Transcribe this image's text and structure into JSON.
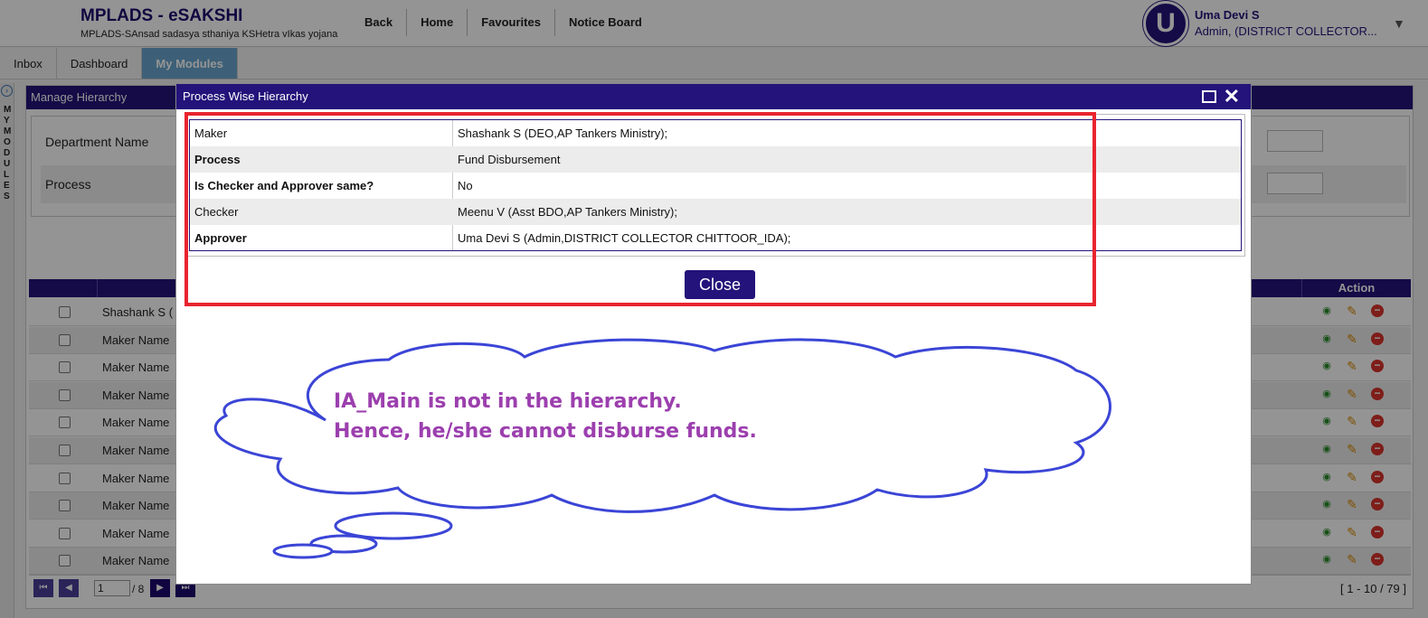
{
  "header": {
    "brand_title": "MPLADS - eSAKSHI",
    "brand_subtitle": "MPLADS-SAnsad sadasya sthaniya KSHetra vIkas yojana",
    "nav": [
      "Back",
      "Home",
      "Favourites",
      "Notice Board"
    ],
    "user_initial": "U",
    "user_name": "Uma Devi S",
    "user_role": "Admin, (DISTRICT COLLECTOR..."
  },
  "tabs": [
    {
      "label": "Inbox",
      "active": false
    },
    {
      "label": "Dashboard",
      "active": false
    },
    {
      "label": "My Modules",
      "active": true
    }
  ],
  "rail": {
    "label": "MY MODULES"
  },
  "panel": {
    "title": "Manage Hierarchy",
    "filters": [
      {
        "label": "Department Name"
      },
      {
        "label": "Process"
      }
    ],
    "grid": {
      "action_header": "Action",
      "rows": [
        "Shashank S (",
        "Maker Name",
        "Maker Name",
        "Maker Name",
        "Maker Name",
        "Maker Name",
        "Maker Name",
        "Maker Name",
        "Maker Name",
        "Maker Name"
      ]
    },
    "pager": {
      "page": "1",
      "total": "/ 8",
      "range": "[ 1 - 10 / 79 ]"
    }
  },
  "modal": {
    "title": "Process Wise Hierarchy",
    "rows": [
      {
        "key": "Maker",
        "value": "Shashank S (DEO,AP Tankers Ministry);",
        "bold": false
      },
      {
        "key": "Process",
        "value": "Fund Disbursement",
        "bold": true
      },
      {
        "key": "Is Checker and Approver same?",
        "value": "No",
        "bold": true
      },
      {
        "key": "Checker",
        "value": "Meenu V (Asst BDO,AP Tankers Ministry);",
        "bold": false
      },
      {
        "key": "Approver",
        "value": "Uma Devi S (Admin,DISTRICT COLLECTOR CHITTOOR_IDA);",
        "bold": true
      }
    ],
    "close_label": "Close"
  },
  "annotation": {
    "line1": "IA_Main is not in the hierarchy.",
    "line2": "Hence, he/she cannot disburse funds."
  },
  "colors": {
    "brand": "#23137a",
    "highlight": "#e8252f",
    "cloud": "#3b45d6",
    "annotation_text": "#9c3fae"
  }
}
